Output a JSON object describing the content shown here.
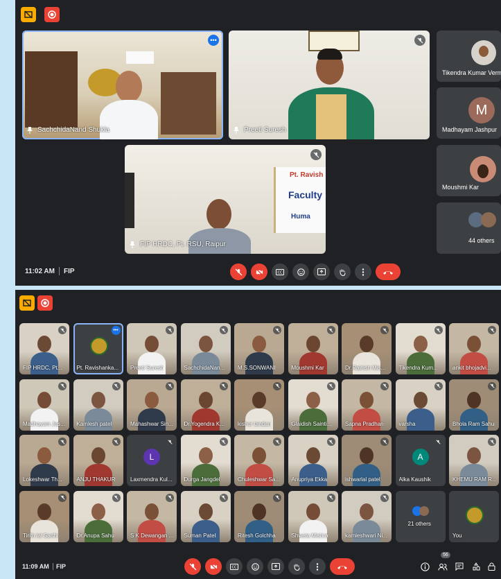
{
  "meet1": {
    "time": "11:02 AM",
    "meeting_code": "FIP",
    "main_tiles": [
      {
        "name": "SachchidaNand Shukla"
      },
      {
        "name": "Preeti Suresh"
      },
      {
        "name": "FIP HRDC, Pt. RSU, Raipur"
      }
    ],
    "side_tiles": [
      {
        "name": "Tikendra Kumar Verma"
      },
      {
        "name": "Madhayam Jashpur",
        "initial": "M"
      },
      {
        "name": "Moushmi Kar"
      },
      {
        "name": "44 others"
      }
    ],
    "banner_texts": [
      "Pt. Ravish",
      "Faculty",
      "Huma"
    ]
  },
  "meet2": {
    "time": "11:09 AM",
    "meeting_code": "FIP",
    "participant_count": "56",
    "grid": [
      "FIP HRDC, Pt...",
      "Pt. Ravishanka...",
      "Preeti Suresh",
      "SachchidaNan...",
      "M.S.SONWANI",
      "Moushmi Kar",
      "Dr.Rajnish Mis...",
      "Tikendra Kum...",
      "ankit bhojadvi...",
      "Madhayam Jas...",
      "Kamlesh patel",
      "Mahashwar Sin...",
      "Dr.Yogendra K...",
      "kishor tandan",
      "Glaidish Sainti...",
      "Sapna Pradhan",
      "varsha",
      "Bhola Ram Sahu",
      "Lokeshwar Th...",
      "ANJU THAKUR",
      "Laxmendra Kul...",
      "Durga Jangdel",
      "Chuleshwar Sa...",
      "Anupriya Ekka",
      "ishwarlal patel",
      "Alka Kaushik",
      "KHEMU RAM R...",
      "Tirith lal Sarthi",
      "Dr.Anupa Sahu",
      "S K Dewangan ...",
      "Suman Patel",
      "Ritesh Golchha",
      "Shweta Mishra",
      "kamleshwari Ni...",
      "21 others",
      "You"
    ],
    "initials": {
      "Laxmendra Kul...": "L",
      "Alka Kaushik": "A"
    }
  },
  "colors": {
    "bg": "#202124",
    "tile": "#3c4043",
    "red": "#ea4335",
    "blue": "#1a73e8",
    "yellow": "#f9ab00",
    "page": "#c9e6f7"
  },
  "icons": [
    "present-icon",
    "record-icon",
    "mic-off-icon",
    "camera-off-icon",
    "captions-icon",
    "emoji-icon",
    "present-screen-icon",
    "raise-hand-icon",
    "more-options-icon",
    "end-call-icon",
    "info-icon",
    "people-icon",
    "chat-icon",
    "activities-icon",
    "host-controls-icon",
    "pin-icon"
  ]
}
